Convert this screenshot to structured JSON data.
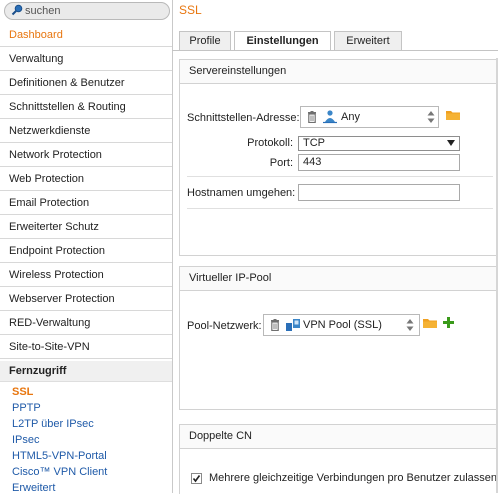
{
  "search": {
    "placeholder": "suchen"
  },
  "sidebar": {
    "items": [
      {
        "label": "Dashboard",
        "active": true
      },
      {
        "label": "Verwaltung"
      },
      {
        "label": "Definitionen & Benutzer"
      },
      {
        "label": "Schnittstellen & Routing"
      },
      {
        "label": "Netzwerkdienste"
      },
      {
        "label": "Network Protection"
      },
      {
        "label": "Web Protection"
      },
      {
        "label": "Email Protection"
      },
      {
        "label": "Erweiterter Schutz"
      },
      {
        "label": "Endpoint Protection"
      },
      {
        "label": "Wireless Protection"
      },
      {
        "label": "Webserver Protection"
      },
      {
        "label": "RED-Verwaltung"
      },
      {
        "label": "Site-to-Site-VPN"
      }
    ],
    "section": {
      "label": "Fernzugriff"
    },
    "subitems": [
      {
        "label": "SSL",
        "active": true
      },
      {
        "label": "PPTP"
      },
      {
        "label": "L2TP über IPsec"
      },
      {
        "label": "IPsec"
      },
      {
        "label": "HTML5-VPN-Portal"
      },
      {
        "label": "Cisco™ VPN Client"
      },
      {
        "label": "Erweitert"
      }
    ]
  },
  "page": {
    "title": "SSL"
  },
  "tabs": [
    {
      "label": "Profile"
    },
    {
      "label": "Einstellungen",
      "active": true
    },
    {
      "label": "Erweitert"
    }
  ],
  "server_settings": {
    "title": "Servereinstellungen",
    "interface_label": "Schnittstellen-Adresse:",
    "interface_value": "Any",
    "protocol_label": "Protokoll:",
    "protocol_value": "TCP",
    "port_label": "Port:",
    "port_value": "443",
    "hostname_label": "Hostnamen umgehen:",
    "hostname_value": ""
  },
  "ip_pool": {
    "title": "Virtueller IP-Pool",
    "network_label": "Pool-Netzwerk:",
    "network_value": "VPN Pool (SSL)"
  },
  "duplicate_cn": {
    "title": "Doppelte CN",
    "checkbox_label": "Mehrere gleichzeitige Verbindungen pro Benutzer zulassen",
    "checked": true
  },
  "colors": {
    "accent": "#e8760f",
    "link": "#1f5aa8",
    "folder": "#f0a020",
    "add": "#3a9a1a"
  }
}
